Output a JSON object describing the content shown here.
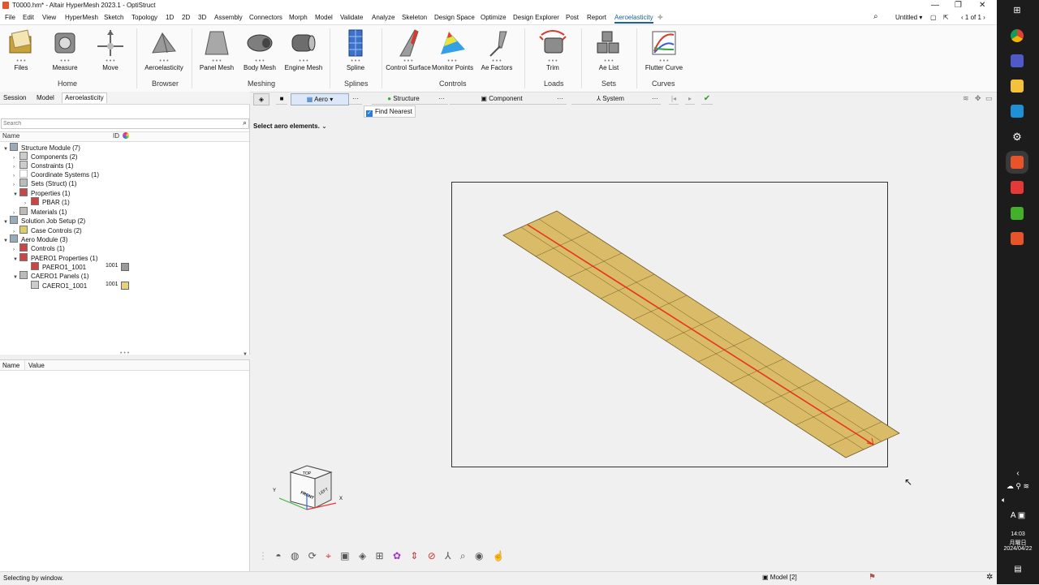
{
  "window": {
    "title": "T0000.hm* - Altair HyperMesh 2023.1 - OptiStruct"
  },
  "menubar": {
    "items": [
      "File",
      "Edit",
      "View",
      "HyperMesh",
      "Sketch",
      "Topology",
      "1D",
      "2D",
      "3D",
      "Assembly",
      "Connectors",
      "Morph",
      "Model",
      "Validate",
      "Analyze",
      "Skeleton",
      "Design Space",
      "Optimize",
      "Design Explorer",
      "Post",
      "Report",
      "Aeroelasticity"
    ],
    "untitled": "Untitled",
    "page": "1 of 1"
  },
  "ribbon": {
    "tools": {
      "files": "Files",
      "measure": "Measure",
      "move": "Move",
      "aeroelasticity": "Aeroelasticity",
      "panel_mesh": "Panel Mesh",
      "body_mesh": "Body Mesh",
      "engine_mesh": "Engine Mesh",
      "spline": "Spline",
      "control_surface": "Control Surface",
      "monitor_points": "Monitor Points",
      "ae_factors": "Ae Factors",
      "trim": "Trim",
      "ae_list": "Ae List",
      "flutter_curve": "Flutter Curve"
    },
    "groups": {
      "home": "Home",
      "browser": "Browser",
      "meshing": "Meshing",
      "splines": "Splines",
      "controls": "Controls",
      "loads": "Loads",
      "sets": "Sets",
      "curves": "Curves"
    }
  },
  "left_tabs": [
    "Session",
    "Model",
    "Aeroelasticity"
  ],
  "browser": {
    "search_placeholder": "Search",
    "col_name": "Name",
    "col_id": "ID",
    "tree": [
      {
        "label": "Structure Module  (7)"
      },
      {
        "label": "Components  (2)"
      },
      {
        "label": "Constraints  (1)"
      },
      {
        "label": "Coordinate Systems  (1)"
      },
      {
        "label": "Sets (Struct)  (1)"
      },
      {
        "label": "Properties  (1)"
      },
      {
        "label": "PBAR  (1)"
      },
      {
        "label": "Materials  (1)"
      },
      {
        "label": "Solution Job Setup  (2)"
      },
      {
        "label": "Case Controls  (2)"
      },
      {
        "label": "Aero Module  (3)"
      },
      {
        "label": "Controls  (1)"
      },
      {
        "label": "PAERO1 Properties  (1)"
      },
      {
        "label": "PAERO1_1001",
        "id": "1001",
        "color": "#999999"
      },
      {
        "label": "CAERO1 Panels  (1)"
      },
      {
        "label": "CAERO1_1001",
        "id": "1001",
        "color": "#e6d27a"
      }
    ]
  },
  "props": {
    "col_name": "Name",
    "col_value": "Value"
  },
  "vp_toolbar": {
    "aero": "Aero",
    "structure": "Structure",
    "component": "Component",
    "system": "System"
  },
  "find_nearest": "Find Nearest",
  "prompt": "Select aero elements.",
  "cube": {
    "top": "TOP",
    "front": "FRONT",
    "left": "LEFT",
    "y": "Y",
    "x": "X"
  },
  "status": {
    "left": "Selecting by window.",
    "model": "Model [2]"
  },
  "clock": {
    "time": "14:03",
    "day": "月曜日",
    "date": "2024/04/22"
  },
  "colors": {
    "accent": "#1b5fa8",
    "panel_fill": "#d9bb68",
    "beam": "#e8331f"
  }
}
